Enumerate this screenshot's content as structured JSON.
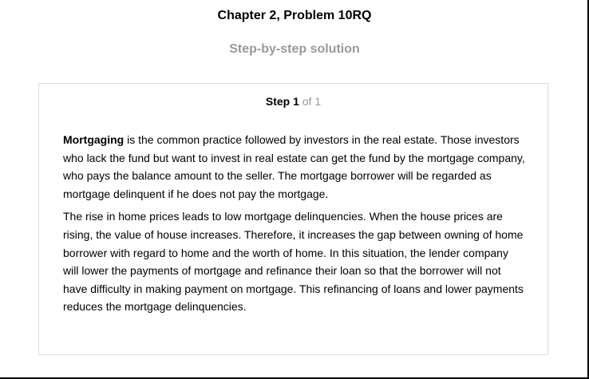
{
  "problem": {
    "title": "Chapter 2, Problem 10RQ",
    "subtitle": "Step-by-step solution"
  },
  "step": {
    "label": "Step 1",
    "of_text": "of 1",
    "paragraph1_term": "Mortgaging",
    "paragraph1_text": " is the common practice followed by investors in the real estate. Those investors who lack the fund but want to invest in real estate can get the fund by the mortgage company, who pays the balance amount to the seller. The mortgage borrower will be regarded as mortgage delinquent if he does not pay the mortgage.",
    "paragraph2_text": "The rise in home prices leads to low mortgage delinquencies. When the house prices are rising, the value of house increases. Therefore, it increases the gap between owning of home borrower with regard to home and the worth of home. In this situation, the lender company will lower the payments of mortgage and refinance their loan so that the borrower will not have difficulty in making payment on mortgage. This refinancing of loans and lower payments reduces the mortgage delinquencies."
  }
}
